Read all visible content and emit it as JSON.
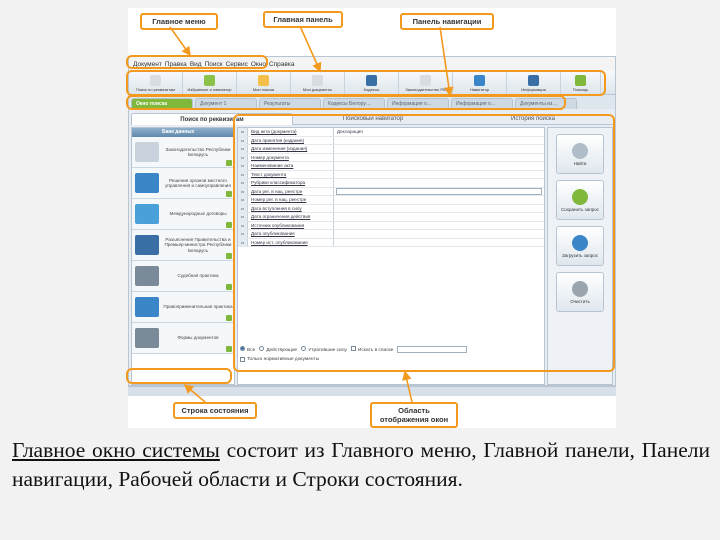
{
  "callouts": {
    "main_menu": "Главное меню",
    "main_panel": "Главная панель",
    "nav_panel": "Панель навигации",
    "status_bar": "Строка состояния",
    "doc_display_area": "Область отображения окон"
  },
  "app": {
    "menu": [
      "Документ",
      "Правка",
      "Вид",
      "Поиск",
      "Сервис",
      "Окно",
      "Справка"
    ],
    "toolbar": [
      {
        "label": "Поиск по реквизитам",
        "icon": "search-icon",
        "color": "#d9dde2"
      },
      {
        "label": "Избранные и навигатор",
        "icon": "star-icon",
        "color": "#8bc34a"
      },
      {
        "label": "Мои поиски",
        "icon": "folder-icon",
        "color": "#f5c04a"
      },
      {
        "label": "Мои документы",
        "icon": "document-icon",
        "color": "#d9dde2"
      },
      {
        "label": "Кодексы",
        "icon": "book-icon",
        "color": "#3a6fa5"
      },
      {
        "label": "Законодательство РБ",
        "icon": "gavel-icon",
        "color": "#d9dde2"
      },
      {
        "label": "Навигатор",
        "icon": "compass-icon",
        "color": "#3a86c8"
      },
      {
        "label": "Информация",
        "icon": "info-icon",
        "color": "#3a6fa5"
      },
      {
        "label": "Помощь",
        "icon": "help-icon",
        "color": "#7fb83a"
      }
    ],
    "tabs": [
      "Окно поиска",
      "Документ 1",
      "Результаты",
      "Кодексы Белору…",
      "Информация о…",
      "Информация о…",
      "Документы из…"
    ],
    "subtabs": [
      "Поиск по реквизитам",
      "Поисковый навигатор",
      "История поиска"
    ],
    "sidebar": {
      "header": "Банк данных",
      "items": [
        {
          "label": "Законодательство Республики Беларусь",
          "color": "#c8d3dd"
        },
        {
          "label": "Решения органов местного управления и самоуправления",
          "color": "#3a86c8"
        },
        {
          "label": "Международные договоры",
          "color": "#4aa0d8"
        },
        {
          "label": "Разъяснения Правительства и Премьер-министра Республики Беларусь",
          "color": "#3a6fa5"
        },
        {
          "label": "Судебная практика",
          "color": "#7a8a98"
        },
        {
          "label": "Правоприменительная практика",
          "color": "#3a86c8"
        },
        {
          "label": "Формы документов",
          "color": "#7a8a98"
        }
      ]
    },
    "form_rows": [
      {
        "op": "и",
        "label": "Вид акта (документа)",
        "value": "Декларация"
      },
      {
        "op": "и",
        "label": "Дата принятия (издания)",
        "value": ""
      },
      {
        "op": "и",
        "label": "Дата изменения (издания)",
        "value": ""
      },
      {
        "op": "и",
        "label": "Номер документа",
        "value": ""
      },
      {
        "op": "и",
        "label": "Наименование акта",
        "value": ""
      },
      {
        "op": "и",
        "label": "Текст документа",
        "value": ""
      },
      {
        "op": "и",
        "label": "Рубрики классификатора",
        "value": ""
      },
      {
        "op": "и",
        "label": "Дата рег. в нац. реестре",
        "value": ""
      },
      {
        "op": "и",
        "label": "Номер рег. в нац. реестре",
        "value": ""
      },
      {
        "op": "и",
        "label": "Дата вступления в силу",
        "value": ""
      },
      {
        "op": "и",
        "label": "Дата ограничения действия",
        "value": ""
      },
      {
        "op": "и",
        "label": "Источник опубликования",
        "value": ""
      },
      {
        "op": "и",
        "label": "Дата опубликования",
        "value": ""
      },
      {
        "op": "и",
        "label": "Номер ист. опубликования",
        "value": ""
      }
    ],
    "radios": [
      "Все",
      "Действующие",
      "Утратившие силу"
    ],
    "search_in_found": "Искать в списке",
    "only_normative": "Только нормативные документы",
    "actions": [
      {
        "label": "Найти",
        "icon": "magnifier-icon",
        "color": "#b0bcc7"
      },
      {
        "label": "Сохранить запрос",
        "icon": "save-icon",
        "color": "#7fb83a"
      },
      {
        "label": "Загрузить запрос",
        "icon": "load-icon",
        "color": "#3a86c8"
      },
      {
        "label": "Очистить",
        "icon": "trash-icon",
        "color": "#9aa5ae"
      }
    ]
  },
  "caption": {
    "part1": "Главное окно системы",
    "part2": " состоит из Главного меню, Главной панели, Панели навигации, Рабочей области и Строки состояния."
  }
}
